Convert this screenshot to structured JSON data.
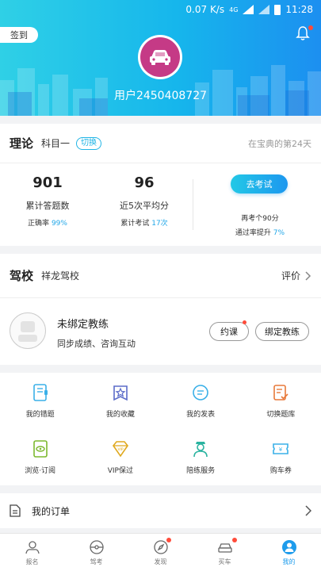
{
  "status_bar": {
    "speed": "0.07 K/s",
    "network": "4G",
    "time": "11:28"
  },
  "header": {
    "signin_label": "签到",
    "username": "用户2450408727"
  },
  "theory": {
    "title": "理论",
    "subject": "科目一",
    "switch_label": "切换",
    "days_text": "在宝典的第24天",
    "total_answered": "901",
    "total_answered_label": "累计答题数",
    "accuracy_label": "正确率",
    "accuracy_value": "99%",
    "avg_score": "96",
    "avg_score_label": "近5次平均分",
    "exam_count_label": "累计考试",
    "exam_count_value": "17次",
    "exam_button": "去考试",
    "pass_hint": "再考个90分",
    "pass_rate_label": "通过率提升",
    "pass_rate_value": "7%"
  },
  "school": {
    "title": "驾校",
    "name": "祥龙驾校",
    "rate_label": "评价",
    "coach_name": "未绑定教练",
    "coach_desc": "同步成绩、咨询互动",
    "appoint_label": "约课",
    "bind_label": "绑定教练"
  },
  "grid": [
    {
      "label": "我的错题",
      "icon": "notebook-icon"
    },
    {
      "label": "我的收藏",
      "icon": "star-bag-icon"
    },
    {
      "label": "我的发表",
      "icon": "chat-bubble-icon"
    },
    {
      "label": "切换题库",
      "icon": "checklist-icon"
    },
    {
      "label": "浏览·订阅",
      "icon": "eye-doc-icon"
    },
    {
      "label": "VIP保过",
      "icon": "vip-diamond-icon"
    },
    {
      "label": "陪练服务",
      "icon": "instructor-icon"
    },
    {
      "label": "购车券",
      "icon": "coupon-icon"
    }
  ],
  "orders": {
    "label": "我的订单"
  },
  "tabs": [
    {
      "label": "报名",
      "icon": "hand-heart-icon",
      "dot": false,
      "active": false
    },
    {
      "label": "驾考",
      "icon": "steering-wheel-icon",
      "dot": false,
      "active": false
    },
    {
      "label": "发现",
      "icon": "compass-icon",
      "dot": true,
      "active": false
    },
    {
      "label": "买车",
      "icon": "car-icon",
      "dot": true,
      "active": false
    },
    {
      "label": "我的",
      "icon": "profile-icon",
      "dot": false,
      "active": true
    }
  ],
  "colors": {
    "accent": "#1e9cec",
    "avatar_bg": "#c53a86",
    "badge": "#ff4b3a"
  }
}
